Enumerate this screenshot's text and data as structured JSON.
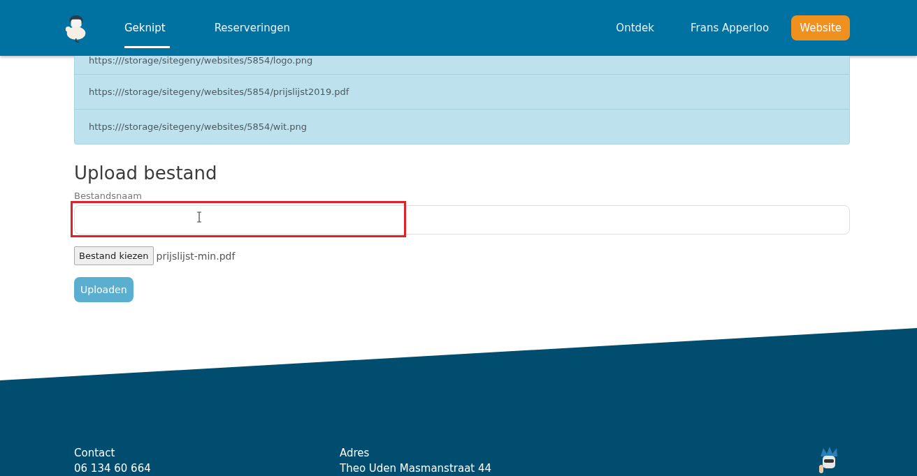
{
  "nav": {
    "items": [
      {
        "label": "Geknipt",
        "selected": true
      },
      {
        "label": "Reserveringen",
        "selected": false
      }
    ],
    "right_links": [
      "Ontdek",
      "Frans Apperloo"
    ],
    "cta": "Website"
  },
  "files": [
    "https:///storage/sitegeny/websites/5854/logo.png",
    "https:///storage/sitegeny/websites/5854/prijslijst2019.pdf",
    "https:///storage/sitegeny/websites/5854/wit.png"
  ],
  "upload": {
    "title": "Upload bestand",
    "field_label": "Bestandsnaam",
    "choose_button": "Bestand kiezen",
    "chosen_file": "prijslijst-min.pdf",
    "submit": "Uploaden"
  },
  "footer": {
    "columns": [
      {
        "heading": "Contact",
        "line": "06 134 60 664"
      },
      {
        "heading": "Adres",
        "line": "Theo Uden Masmanstraat 44"
      }
    ]
  }
}
